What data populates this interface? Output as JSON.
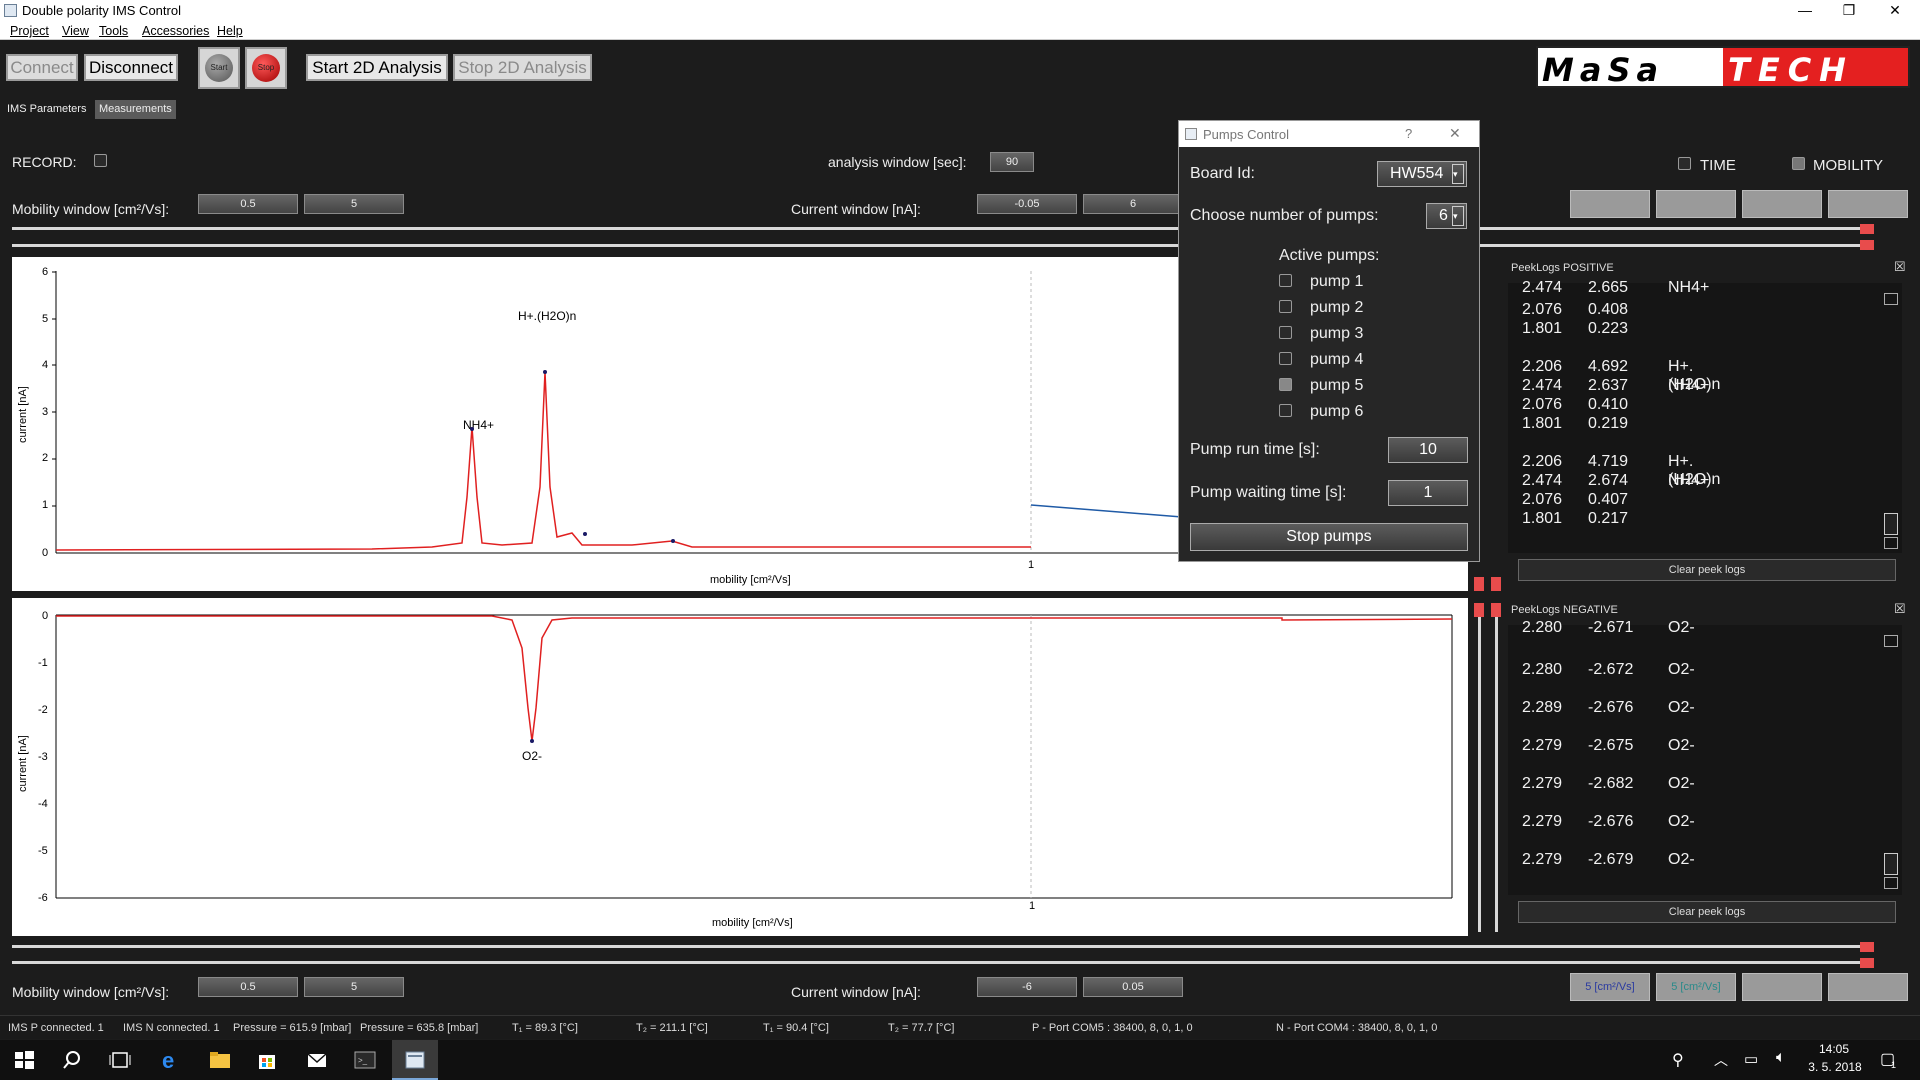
{
  "window": {
    "title": "Double polarity IMS Control"
  },
  "menu": [
    "Project",
    "View",
    "Tools",
    "Accessories",
    "Help"
  ],
  "toolbar": {
    "connect": "Connect",
    "disconnect": "Disconnect",
    "start_round": "Start",
    "stop_round": "Stop",
    "start_2d": "Start 2D Analysis",
    "stop_2d": "Stop 2D Analysis"
  },
  "logo": {
    "left": "MaSa",
    "right": "TECH"
  },
  "tabs": [
    "IMS Parameters",
    "Measurements"
  ],
  "params": {
    "record_label": "RECORD:",
    "analysis_window_label": "analysis window [sec]:",
    "analysis_window_value": "90",
    "mobility_window_label": "Mobility window [cm²/Vs]:",
    "mobility_min_top": "0.5",
    "mobility_max_top": "5",
    "current_window_label": "Current window [nA]:",
    "current_min_top": "-0.05",
    "current_max_top": "6",
    "time_label": "TIME",
    "mobility_label": "MOBILITY",
    "mobility_min_bottom": "0.5",
    "mobility_max_bottom": "5",
    "current_min_bottom": "-6",
    "current_max_bottom": "0.05",
    "unit_btn_1": "5 [cm²/Vs]",
    "unit_btn_2": "5 [cm²/Vs]"
  },
  "plot_positive": {
    "ylabel": "current [nA]",
    "xlabel": "mobility [cm²/Vs]",
    "yticks": [
      "6",
      "5",
      "4",
      "3",
      "2",
      "1",
      "0"
    ],
    "xtick": "1",
    "peak_labels": [
      "NH4+",
      "H+.(H2O)n"
    ]
  },
  "plot_negative": {
    "ylabel": "current [nA]",
    "xlabel": "mobility [cm²/Vs]",
    "yticks": [
      "0",
      "-1",
      "-2",
      "-3",
      "-4",
      "-5",
      "-6"
    ],
    "xtick": "1",
    "peak_labels": [
      "O2-"
    ]
  },
  "peeklogs_positive": {
    "title": "PeekLogs POSITIVE",
    "rows": [
      [
        "2.474",
        "2.665",
        "NH4+"
      ],
      [
        "2.076",
        "0.408",
        ""
      ],
      [
        "1.801",
        "0.223",
        ""
      ],
      [
        "2.206",
        "4.692",
        "H+.(H2O)n"
      ],
      [
        "2.474",
        "2.637",
        "NH4+"
      ],
      [
        "2.076",
        "0.410",
        ""
      ],
      [
        "1.801",
        "0.219",
        ""
      ],
      [
        "2.206",
        "4.719",
        "H+.(H2O)n"
      ],
      [
        "2.474",
        "2.674",
        "NH4+"
      ],
      [
        "2.076",
        "0.407",
        ""
      ],
      [
        "1.801",
        "0.217",
        ""
      ]
    ],
    "clear": "Clear peek logs"
  },
  "peeklogs_negative": {
    "title": "PeekLogs NEGATIVE",
    "rows": [
      [
        "2.280",
        "-2.671",
        "O2-"
      ],
      [
        "2.280",
        "-2.672",
        "O2-"
      ],
      [
        "2.289",
        "-2.676",
        "O2-"
      ],
      [
        "2.279",
        "-2.675",
        "O2-"
      ],
      [
        "2.279",
        "-2.682",
        "O2-"
      ],
      [
        "2.279",
        "-2.676",
        "O2-"
      ],
      [
        "2.279",
        "-2.679",
        "O2-"
      ]
    ],
    "clear": "Clear peek logs"
  },
  "pumps_dialog": {
    "title": "Pumps Control",
    "help": "?",
    "close": "✕",
    "board_id_label": "Board Id:",
    "board_id_value": "HW554",
    "num_pumps_label": "Choose number of pumps:",
    "num_pumps_value": "6",
    "active_pumps_label": "Active pumps:",
    "pumps": [
      "pump 1",
      "pump 2",
      "pump 3",
      "pump 4",
      "pump 5",
      "pump 6"
    ],
    "pump_checked": [
      false,
      false,
      false,
      false,
      true,
      false
    ],
    "run_time_label": "Pump run time [s]:",
    "run_time_value": "10",
    "wait_time_label": "Pump waiting time [s]:",
    "wait_time_value": "1",
    "stop_button": "Stop pumps"
  },
  "status": {
    "ims_p": "IMS P connected.  1",
    "ims_n": "IMS N connected.  1",
    "pressure1": "Pressure = 615.9 [mbar]",
    "pressure2": "Pressure = 635.8 [mbar]",
    "t1a": "T₁ = 89.3 [°C]",
    "t2a": "T₂ = 211.1 [°C]",
    "t1b": "T₁ = 90.4 [°C]",
    "t2b": "T₂ = 77.7 [°C]",
    "p_port": "P - Port COM5 : 38400, 8, 0, 1, 0",
    "n_port": "N - Port COM4 : 38400, 8, 0, 1, 0"
  },
  "taskbar": {
    "time": "14:05",
    "date": "3. 5. 2018",
    "notif_count": "1"
  },
  "colors": {
    "trace": "#e02020",
    "accent_red": "#e42020",
    "blue_line": "#1f5aa6"
  }
}
